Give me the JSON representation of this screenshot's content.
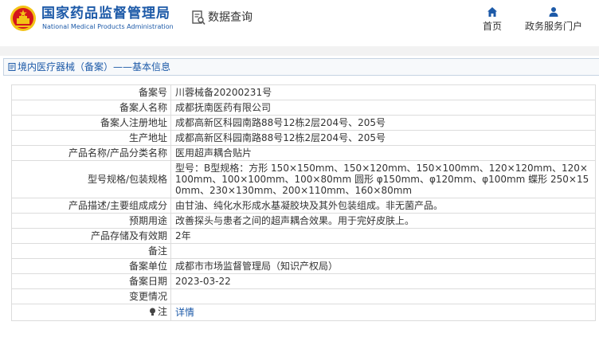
{
  "header": {
    "org_name_cn": "国家药品监督管理局",
    "org_name_en": "National Medical Products Administration",
    "query_label": "数据查询",
    "nav": [
      {
        "label": "首页",
        "icon": "home-icon"
      },
      {
        "label": "政务服务门户",
        "icon": "user-icon"
      }
    ]
  },
  "breadcrumb": {
    "text": "境内医疗器械（备案）——基本信息",
    "icon": "document-icon"
  },
  "colors": {
    "brand_blue": "#1d5aa8",
    "emblem_red": "#d4161c",
    "emblem_gold": "#f3c316",
    "border": "#dcdcdc",
    "divider_bg": "#f2f2f2"
  },
  "record": {
    "rows": [
      {
        "label": "备案号",
        "value": "川蓉械备20200231号"
      },
      {
        "label": "备案人名称",
        "value": "成都抚南医药有限公司"
      },
      {
        "label": "备案人注册地址",
        "value": "成都高新区科园南路88号12栋2层204号、205号"
      },
      {
        "label": "生产地址",
        "value": "成都高新区科园南路88号12栋2层204号、205号"
      },
      {
        "label": "产品名称/产品分类名称",
        "value": "医用超声耦合贴片"
      },
      {
        "label": "型号规格/包装规格",
        "value": "型号：B型规格：方形 150×150mm、150×120mm、150×100mm、120×120mm、120×100mm、100×100mm、100×80mm 圆形 φ150mm、φ120mm、φ100mm 蝶形 250×150mm、230×130mm、200×110mm、160×80mm"
      },
      {
        "label": "产品描述/主要组成成分",
        "value": "由甘油、纯化水形成水基凝胶块及其外包装组成。非无菌产品。"
      },
      {
        "label": "预期用途",
        "value": "改善探头与患者之间的超声耦合效果。用于完好皮肤上。"
      },
      {
        "label": "产品存储及有效期",
        "value": "2年"
      },
      {
        "label": "备注",
        "value": ""
      },
      {
        "label": "备案单位",
        "value": "成都市市场监督管理局（知识产权局）"
      },
      {
        "label": "备案日期",
        "value": "2023-03-22"
      },
      {
        "label": "变更情况",
        "value": ""
      },
      {
        "label": "注",
        "value": "详情"
      }
    ]
  }
}
